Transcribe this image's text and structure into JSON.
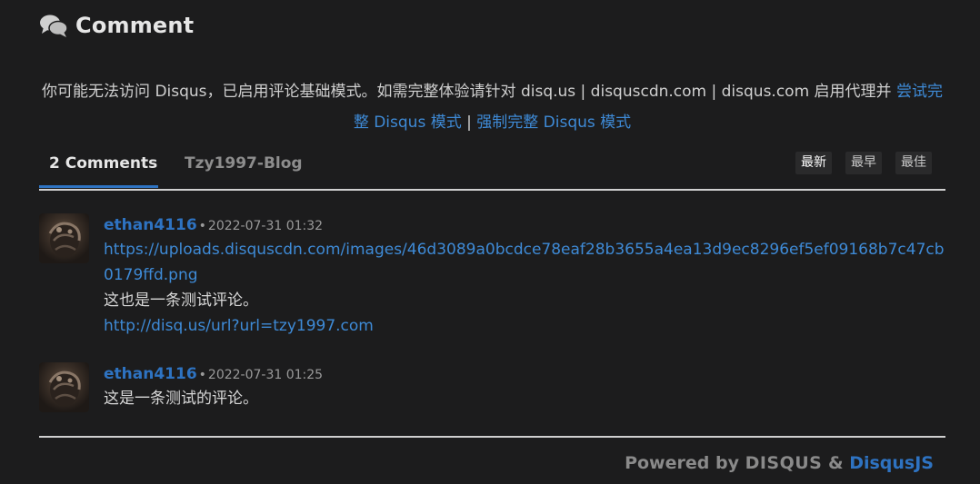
{
  "header": {
    "title": "Comment",
    "icon": "comments-icon"
  },
  "notice": {
    "text": "你可能无法访问 Disqus，已启用评论基础模式。如需完整体验请针对 disq.us | disquscdn.com | disqus.com 启用代理并 ",
    "link_try": "尝试完整 Disqus 模式",
    "separator": " | ",
    "link_force": "强制完整 Disqus 模式"
  },
  "tabs": {
    "comments_count": "2 Comments",
    "site": "Tzy1997-Blog"
  },
  "sort": {
    "newest": "最新",
    "oldest": "最早",
    "best": "最佳"
  },
  "comments": [
    {
      "author": "ethan4116",
      "separator": "•",
      "time": "2022-07-31 01:32",
      "link1": "https://uploads.disquscdn.com/images/46d3089a0bcdce78eaf28b3655a4ea13d9ec8296ef5ef09168b7c47cb0179ffd.png",
      "text": "这也是一条测试评论。",
      "link2": "http://disq.us/url?url=tzy1997.com"
    },
    {
      "author": "ethan4116",
      "separator": "•",
      "time": "2022-07-31 01:25",
      "text": "这是一条测试的评论。"
    }
  ],
  "footer": {
    "powered_by": "Powered by",
    "disqus": "DISQUS",
    "amp": "&",
    "disqusjs": "DisqusJS"
  },
  "colors": {
    "background": "#1c1c1d",
    "accent": "#2e73c2",
    "link": "#3e8ad6"
  }
}
